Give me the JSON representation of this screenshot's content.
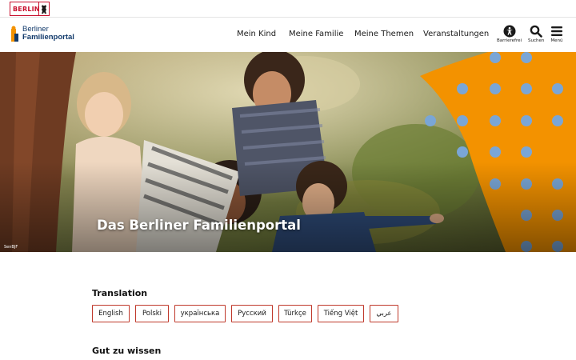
{
  "topbar": {
    "berlin_label": "BERLIN"
  },
  "header": {
    "logo_line1": "Berliner",
    "logo_line2": "Familienportal",
    "nav": [
      "Mein Kind",
      "Meine Familie",
      "Meine Themen",
      "Veranstaltungen"
    ],
    "tools": {
      "accessibility": "Barrierefrei",
      "search": "Suchen",
      "menu": "Menü"
    }
  },
  "hero": {
    "title": "Das Berliner Familienportal",
    "credit": "SenBJF"
  },
  "translation": {
    "heading": "Translation",
    "languages": [
      "English",
      "Polski",
      "українська",
      "Русский",
      "Türkçe",
      "Tiếng Việt",
      "عربي"
    ]
  },
  "next_section": {
    "heading": "Gut zu wissen"
  },
  "colors": {
    "berlin_red": "#c8102e",
    "brand_blue": "#123a6b",
    "orange": "#f39200",
    "dot_blue": "#7aa6d6",
    "button_border": "#c0392b"
  }
}
